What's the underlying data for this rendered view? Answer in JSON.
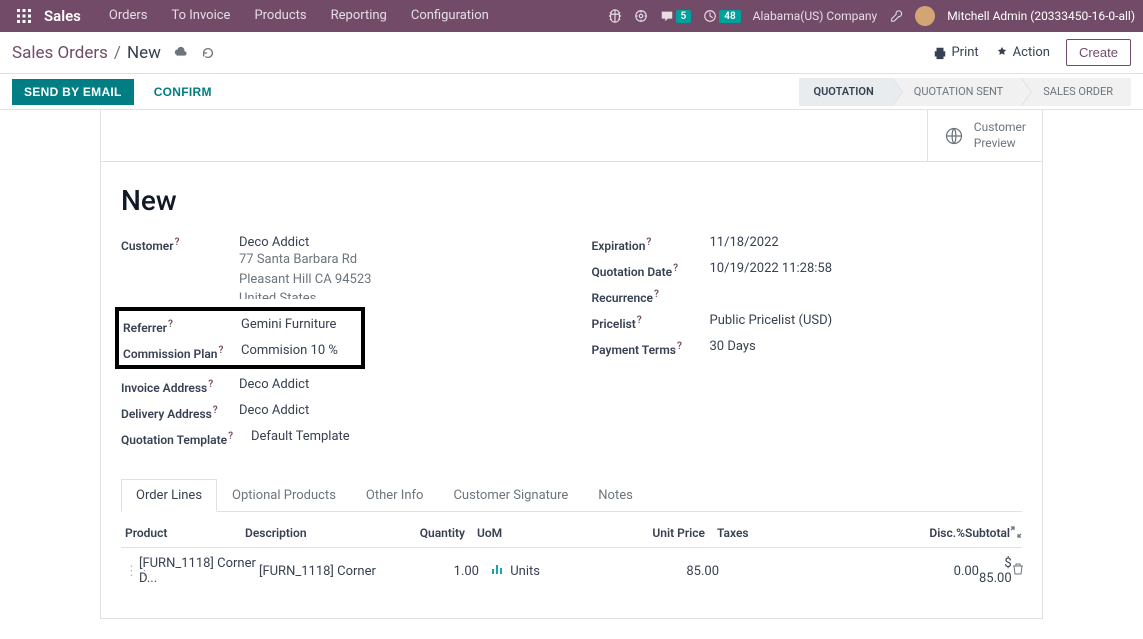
{
  "navbar": {
    "brand": "Sales",
    "menu": [
      "Orders",
      "To Invoice",
      "Products",
      "Reporting",
      "Configuration"
    ],
    "msg_count": "5",
    "activity_count": "48",
    "company": "Alabama(US) Company",
    "user": "Mitchell Admin (20333450-16-0-all)"
  },
  "breadcrumb": {
    "root": "Sales Orders",
    "current": "New"
  },
  "controls": {
    "print": "Print",
    "action": "Action",
    "create": "Create"
  },
  "status_buttons": {
    "send": "SEND BY EMAIL",
    "confirm": "CONFIRM"
  },
  "stages": [
    "QUOTATION",
    "QUOTATION SENT",
    "SALES ORDER"
  ],
  "stat_btn": {
    "l1": "Customer",
    "l2": "Preview"
  },
  "form": {
    "title": "New",
    "left": {
      "customer_label": "Customer",
      "customer_value": "Deco Addict",
      "addr1": "77 Santa Barbara Rd",
      "addr2": "Pleasant Hill CA 94523",
      "addr3": "United States",
      "referrer_label": "Referrer",
      "referrer_value": "Gemini Furniture",
      "commission_label": "Commission Plan",
      "commission_value": "Commision 10 %",
      "inv_addr_label": "Invoice Address",
      "inv_addr_value": "Deco Addict",
      "del_addr_label": "Delivery Address",
      "del_addr_value": "Deco Addict",
      "tmpl_label": "Quotation Template",
      "tmpl_value": "Default Template"
    },
    "right": {
      "exp_label": "Expiration",
      "exp_value": "11/18/2022",
      "qdate_label": "Quotation Date",
      "qdate_value": "10/19/2022 11:28:58",
      "recur_label": "Recurrence",
      "recur_value": "",
      "pricelist_label": "Pricelist",
      "pricelist_value": "Public Pricelist (USD)",
      "pterms_label": "Payment Terms",
      "pterms_value": "30 Days"
    }
  },
  "tabs": [
    "Order Lines",
    "Optional Products",
    "Other Info",
    "Customer Signature",
    "Notes"
  ],
  "table": {
    "headers": {
      "product": "Product",
      "desc": "Description",
      "qty": "Quantity",
      "uom": "UoM",
      "unit": "Unit Price",
      "taxes": "Taxes",
      "disc": "Disc.%",
      "sub": "Subtotal"
    },
    "row": {
      "product": "[FURN_1118] Corner D...",
      "desc": "[FURN_1118] Corner",
      "qty": "1.00",
      "uom": "Units",
      "unit": "85.00",
      "taxes": "",
      "disc": "0.00",
      "sub": "$ 85.00"
    }
  }
}
